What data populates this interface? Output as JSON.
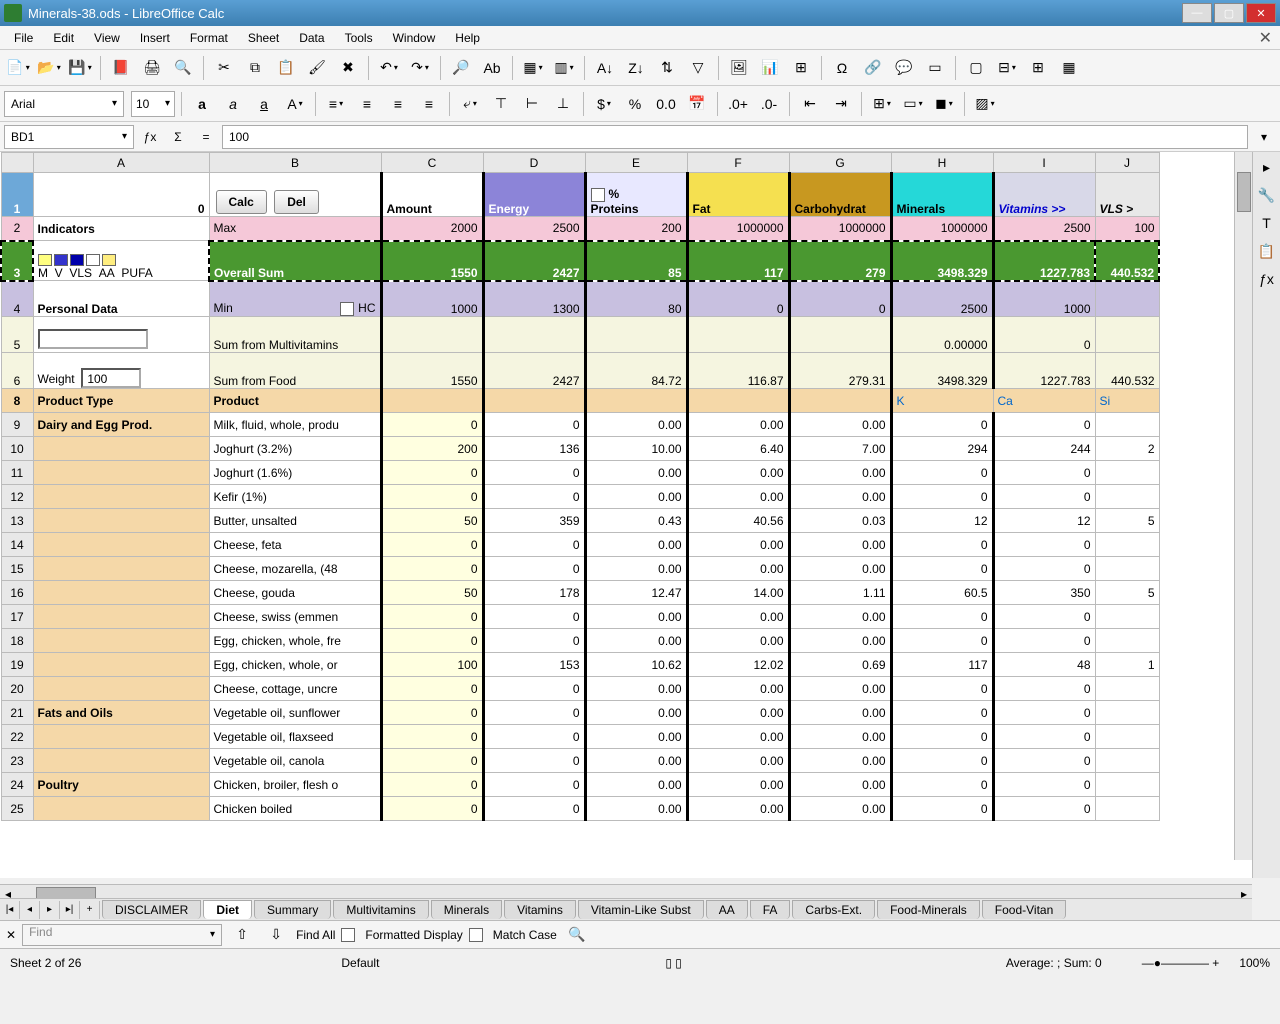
{
  "window": {
    "title": "Minerals-38.ods - LibreOffice Calc"
  },
  "menu": [
    "File",
    "Edit",
    "View",
    "Insert",
    "Format",
    "Sheet",
    "Data",
    "Tools",
    "Window",
    "Help"
  ],
  "font": {
    "name": "Arial",
    "size": "10"
  },
  "cellref": "BD1",
  "formula": "100",
  "columns": [
    "A",
    "B",
    "C",
    "D",
    "E",
    "F",
    "G",
    "H",
    "I",
    "J"
  ],
  "row1": {
    "a_val": "0",
    "calc": "Calc",
    "del": "Del",
    "amount": "Amount",
    "energy": "Energy",
    "proteins_pct": "%",
    "proteins": "Proteins",
    "fat": "Fat",
    "carb": "Carbohydrat",
    "minerals": "Minerals",
    "vitamins": "Vitamins >>",
    "vls": "VLS >"
  },
  "row2": {
    "a": "Indicators",
    "b": "Max",
    "c": "2000",
    "d": "2500",
    "e": "200",
    "f": "1000000",
    "g": "1000000",
    "h": "1000000",
    "i": "2500",
    "j": "100"
  },
  "row3": {
    "leg_labels": [
      "M",
      "V",
      "VLS",
      "AA",
      "PUFA"
    ],
    "b": "Overall Sum",
    "c": "1550",
    "d": "2427",
    "e": "85",
    "f": "117",
    "g": "279",
    "h": "3498.329",
    "i": "1227.783",
    "j": "440.532"
  },
  "row4": {
    "a": "Personal Data",
    "hc": "HC",
    "b": "Min",
    "c": "1000",
    "d": "1300",
    "e": "80",
    "f": "0",
    "g": "0",
    "h": "2500",
    "i": "1000",
    "j": ""
  },
  "row5": {
    "b": "Sum from Multivitamins",
    "h": "0.00000",
    "i": "0"
  },
  "row6": {
    "a": "Weight",
    "weight_val": "100",
    "b": "Sum from Food",
    "c": "1550",
    "d": "2427",
    "e": "84.72",
    "f": "116.87",
    "g": "279.31",
    "h": "3498.329",
    "i": "1227.783",
    "j": "440.532"
  },
  "row8": {
    "a": "Product Type",
    "b": "Product",
    "h": "K",
    "i": "Ca",
    "j": "Si"
  },
  "rows": [
    {
      "n": "9",
      "a": "Dairy and Egg Prod.",
      "b": "Milk, fluid, whole, produ",
      "c": "0",
      "d": "0",
      "e": "0.00",
      "f": "0.00",
      "g": "0.00",
      "h": "0",
      "i": "0",
      "j": ""
    },
    {
      "n": "10",
      "a": "",
      "b": "Joghurt (3.2%)",
      "c": "200",
      "d": "136",
      "e": "10.00",
      "f": "6.40",
      "g": "7.00",
      "h": "294",
      "i": "244",
      "j": "2"
    },
    {
      "n": "11",
      "a": "",
      "b": "Joghurt (1.6%)",
      "c": "0",
      "d": "0",
      "e": "0.00",
      "f": "0.00",
      "g": "0.00",
      "h": "0",
      "i": "0",
      "j": ""
    },
    {
      "n": "12",
      "a": "",
      "b": "Kefir (1%)",
      "c": "0",
      "d": "0",
      "e": "0.00",
      "f": "0.00",
      "g": "0.00",
      "h": "0",
      "i": "0",
      "j": ""
    },
    {
      "n": "13",
      "a": "",
      "b": "Butter, unsalted",
      "c": "50",
      "d": "359",
      "e": "0.43",
      "f": "40.56",
      "g": "0.03",
      "h": "12",
      "i": "12",
      "j": "5"
    },
    {
      "n": "14",
      "a": "",
      "b": "Cheese, feta",
      "c": "0",
      "d": "0",
      "e": "0.00",
      "f": "0.00",
      "g": "0.00",
      "h": "0",
      "i": "0",
      "j": ""
    },
    {
      "n": "15",
      "a": "",
      "b": "Cheese, mozarella, (48",
      "c": "0",
      "d": "0",
      "e": "0.00",
      "f": "0.00",
      "g": "0.00",
      "h": "0",
      "i": "0",
      "j": ""
    },
    {
      "n": "16",
      "a": "",
      "b": "Cheese, gouda",
      "c": "50",
      "d": "178",
      "e": "12.47",
      "f": "14.00",
      "g": "1.11",
      "h": "60.5",
      "i": "350",
      "j": "5"
    },
    {
      "n": "17",
      "a": "",
      "b": "Cheese, swiss (emmen",
      "c": "0",
      "d": "0",
      "e": "0.00",
      "f": "0.00",
      "g": "0.00",
      "h": "0",
      "i": "0",
      "j": ""
    },
    {
      "n": "18",
      "a": "",
      "b": "Egg, chicken, whole, fre",
      "c": "0",
      "d": "0",
      "e": "0.00",
      "f": "0.00",
      "g": "0.00",
      "h": "0",
      "i": "0",
      "j": ""
    },
    {
      "n": "19",
      "a": "",
      "b": "Egg, chicken, whole, or",
      "c": "100",
      "d": "153",
      "e": "10.62",
      "f": "12.02",
      "g": "0.69",
      "h": "117",
      "i": "48",
      "j": "1"
    },
    {
      "n": "20",
      "a": "",
      "b": "Cheese, cottage, uncre",
      "c": "0",
      "d": "0",
      "e": "0.00",
      "f": "0.00",
      "g": "0.00",
      "h": "0",
      "i": "0",
      "j": ""
    },
    {
      "n": "21",
      "a": "Fats and Oils",
      "b": "Vegetable oil, sunflower",
      "c": "0",
      "d": "0",
      "e": "0.00",
      "f": "0.00",
      "g": "0.00",
      "h": "0",
      "i": "0",
      "j": ""
    },
    {
      "n": "22",
      "a": "",
      "b": "Vegetable oil, flaxseed",
      "c": "0",
      "d": "0",
      "e": "0.00",
      "f": "0.00",
      "g": "0.00",
      "h": "0",
      "i": "0",
      "j": ""
    },
    {
      "n": "23",
      "a": "",
      "b": "Vegetable oil, canola",
      "c": "0",
      "d": "0",
      "e": "0.00",
      "f": "0.00",
      "g": "0.00",
      "h": "0",
      "i": "0",
      "j": ""
    },
    {
      "n": "24",
      "a": "Poultry",
      "b": "Chicken, broiler, flesh o",
      "c": "0",
      "d": "0",
      "e": "0.00",
      "f": "0.00",
      "g": "0.00",
      "h": "0",
      "i": "0",
      "j": ""
    },
    {
      "n": "25",
      "a": "",
      "b": "Chicken boiled",
      "c": "0",
      "d": "0",
      "e": "0.00",
      "f": "0.00",
      "g": "0.00",
      "h": "0",
      "i": "0",
      "j": ""
    }
  ],
  "tabs": [
    "DISCLAIMER",
    "Diet",
    "Summary",
    "Multivitamins",
    "Minerals",
    "Vitamins",
    "Vitamin-Like Subst",
    "AA",
    "FA",
    "Carbs-Ext.",
    "Food-Minerals",
    "Food-Vitan"
  ],
  "active_tab": "Diet",
  "find": {
    "placeholder": "Find",
    "findall": "Find All",
    "formatted": "Formatted Display",
    "matchcase": "Match Case"
  },
  "status": {
    "sheet": "Sheet 2 of 26",
    "style": "Default",
    "agg": "Average: ; Sum: 0",
    "zoom": "100%"
  }
}
